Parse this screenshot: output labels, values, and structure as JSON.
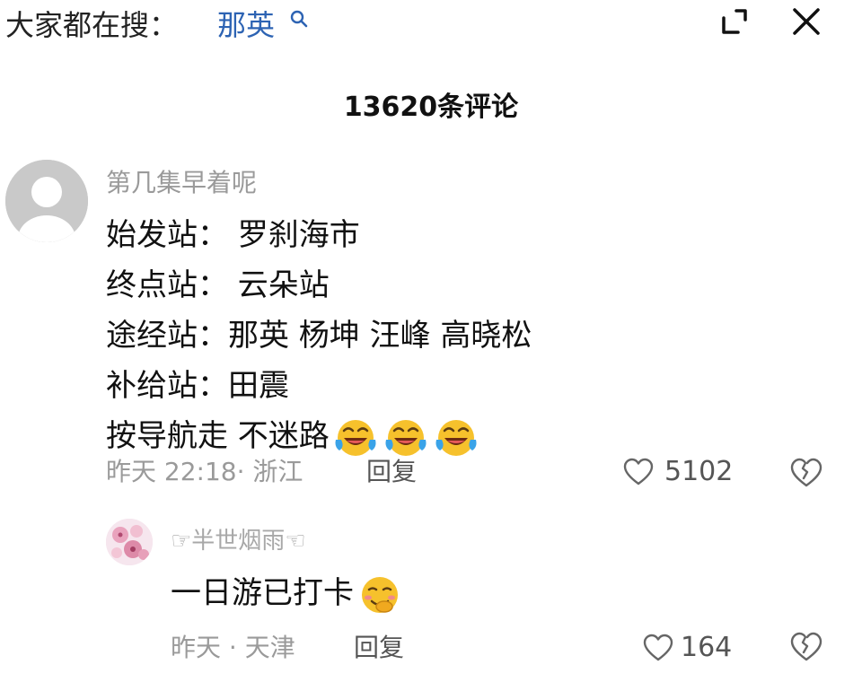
{
  "header": {
    "search_prefix": "大家都在搜：",
    "search_term": "那英",
    "search_icon": "search-icon",
    "expand_icon": "expand-icon",
    "close_icon": "close-icon"
  },
  "comment_count": "13620条评论",
  "comments": [
    {
      "username": "第几集早着呢",
      "avatar": "default-avatar",
      "lines": [
        "始发站：  罗刹海市",
        "终点站：  云朵站",
        "途经站：那英 杨坤 汪峰 高晓松",
        "补给站：田震",
        "按导航走 不迷路"
      ],
      "emoji": "laughing-crying-emoji",
      "meta": "昨天 22:18· 浙江",
      "reply_label": "回复",
      "like_count": "5102",
      "replies": [
        {
          "username": "☞半世烟雨☜",
          "avatar": "pink-flower-avatar",
          "text": "一日游已打卡",
          "emoji": "shy-smile-emoji",
          "meta": "昨天 · 天津",
          "reply_label": "回复",
          "like_count": "164"
        }
      ]
    }
  ],
  "colors": {
    "search_term": "#2d63b3",
    "meta_text": "#9a9a9a",
    "emoji_face": "#f6c12c"
  }
}
